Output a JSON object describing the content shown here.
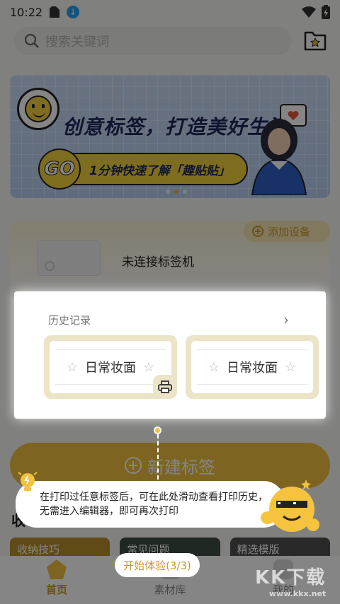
{
  "status_bar": {
    "time": "10:22"
  },
  "search": {
    "placeholder": "搜索关键词"
  },
  "banner": {
    "headline": "创意标签，打造美好生活",
    "go_label": "GO",
    "subline": "1分钟快速了解「趣贴贴」",
    "page_count": 3,
    "active_page": 2
  },
  "device": {
    "title": "未连接标签机",
    "add_button": "添加设备"
  },
  "history": {
    "title": "历史记录",
    "items": [
      {
        "label": "日常妆面"
      },
      {
        "label": "日常妆面"
      }
    ]
  },
  "new_label_button": "新建标签",
  "section_title": "收",
  "cards": [
    {
      "label": "收纳技巧"
    },
    {
      "label": "常见问题"
    },
    {
      "label": "精选模版"
    }
  ],
  "tip": {
    "text": "在打印过任意标签后，可在此处滑动查看打印历史，无需进入编辑器，即可再次打印"
  },
  "guide_button": "开始体验(3/3)",
  "tabs": [
    {
      "label": "首页",
      "active": true
    },
    {
      "label": "素材库",
      "active": false
    },
    {
      "label": "我的",
      "active": false
    }
  ],
  "watermark": {
    "text": "KK下载",
    "sub": "www.kkx.net"
  },
  "colors": {
    "accent": "#f0c240",
    "accent_text": "#c89a2a",
    "banner_bg": "#c9dcf5"
  }
}
